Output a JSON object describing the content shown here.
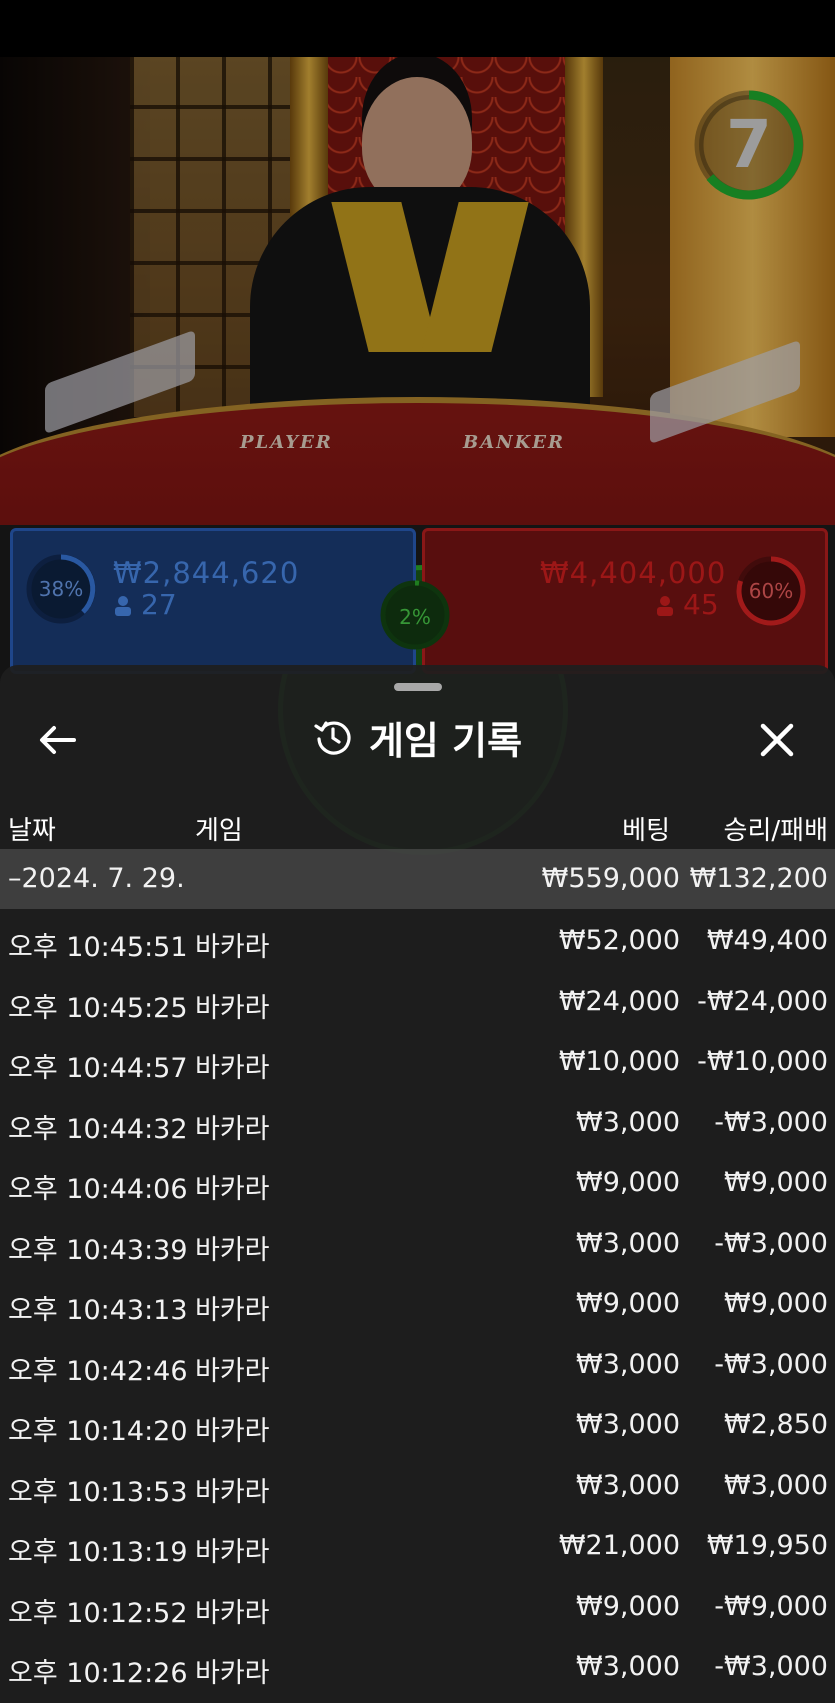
{
  "timer": {
    "value": "7"
  },
  "table": {
    "player_label": "PLAYER",
    "banker_label": "BANKER"
  },
  "bets": {
    "player": {
      "percent": "38%",
      "amount": "₩2,844,620",
      "players": "27",
      "color": "#2c62c0"
    },
    "tie": {
      "percent": "2%",
      "color": "#2cae2c"
    },
    "banker": {
      "percent": "60%",
      "amount": "₩4,404,000",
      "players": "45",
      "color": "#d02020"
    }
  },
  "history": {
    "title": "게임 기록",
    "columns": {
      "date": "날짜",
      "game": "게임",
      "bet": "베팅",
      "result": "승리/패배"
    },
    "summary": {
      "date": "–2024. 7. 29.",
      "bet": "₩559,000",
      "result": "₩132,200"
    },
    "rows": [
      {
        "time": "오후 10:45:51",
        "game": "바카라",
        "bet": "₩52,000",
        "result": "₩49,400"
      },
      {
        "time": "오후 10:45:25",
        "game": "바카라",
        "bet": "₩24,000",
        "result": "-₩24,000"
      },
      {
        "time": "오후 10:44:57",
        "game": "바카라",
        "bet": "₩10,000",
        "result": "-₩10,000"
      },
      {
        "time": "오후 10:44:32",
        "game": "바카라",
        "bet": "₩3,000",
        "result": "-₩3,000"
      },
      {
        "time": "오후 10:44:06",
        "game": "바카라",
        "bet": "₩9,000",
        "result": "₩9,000"
      },
      {
        "time": "오후 10:43:39",
        "game": "바카라",
        "bet": "₩3,000",
        "result": "-₩3,000"
      },
      {
        "time": "오후 10:43:13",
        "game": "바카라",
        "bet": "₩9,000",
        "result": "₩9,000"
      },
      {
        "time": "오후 10:42:46",
        "game": "바카라",
        "bet": "₩3,000",
        "result": "-₩3,000"
      },
      {
        "time": "오후 10:14:20",
        "game": "바카라",
        "bet": "₩3,000",
        "result": "₩2,850"
      },
      {
        "time": "오후 10:13:53",
        "game": "바카라",
        "bet": "₩3,000",
        "result": "₩3,000"
      },
      {
        "time": "오후 10:13:19",
        "game": "바카라",
        "bet": "₩21,000",
        "result": "₩19,950"
      },
      {
        "time": "오후 10:12:52",
        "game": "바카라",
        "bet": "₩9,000",
        "result": "-₩9,000"
      },
      {
        "time": "오후 10:12:26",
        "game": "바카라",
        "bet": "₩3,000",
        "result": "-₩3,000"
      }
    ]
  }
}
